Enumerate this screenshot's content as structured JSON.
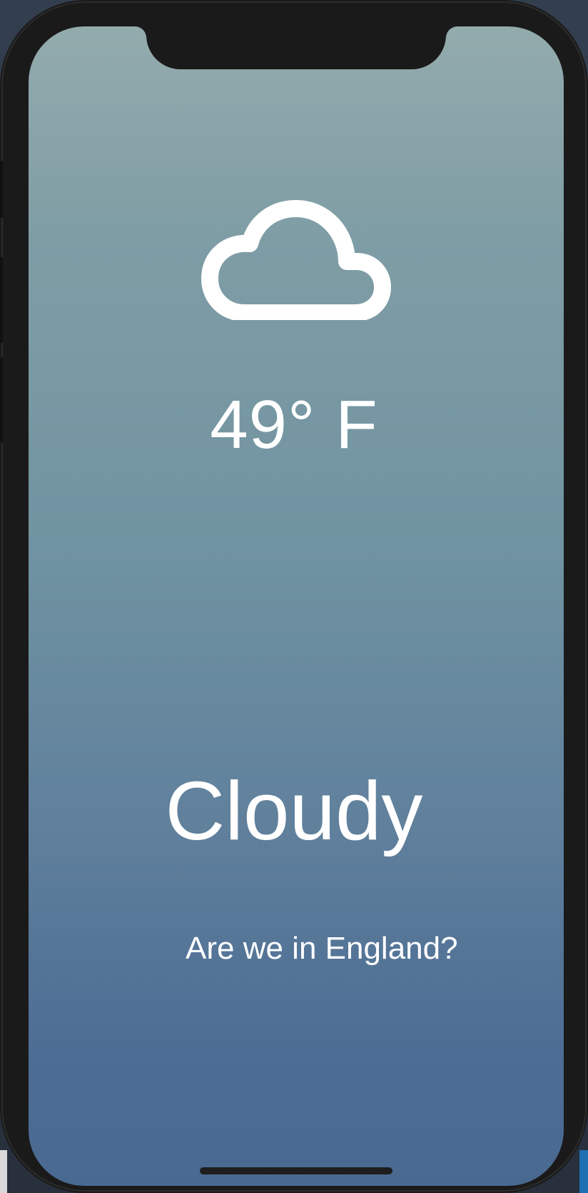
{
  "weather": {
    "icon": "cloud-icon",
    "temperature": "49° F",
    "condition": "Cloudy",
    "message": "Are we in England?"
  },
  "colors": {
    "gradient_top": "#93abad",
    "gradient_bottom": "#496991",
    "text": "#ffffff",
    "bezel": "#1a1a1a"
  }
}
